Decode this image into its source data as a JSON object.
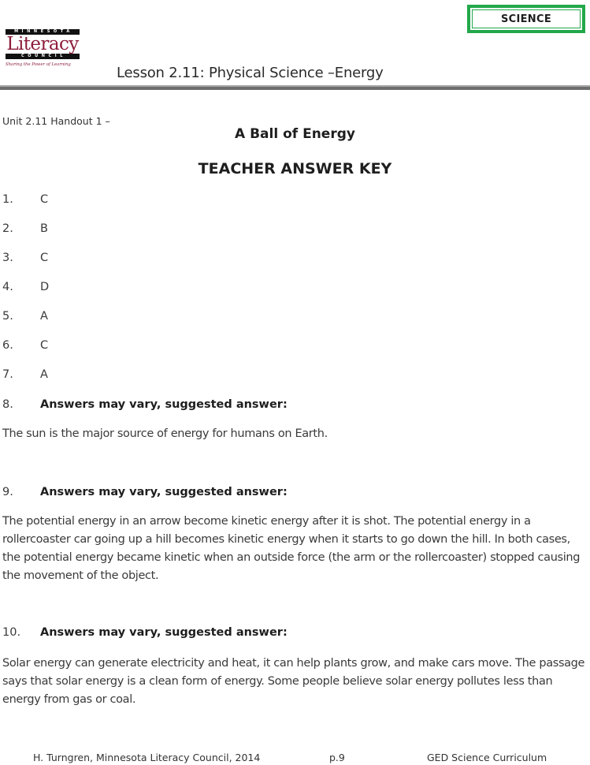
{
  "badge": {
    "label": "SCIENCE",
    "color": "#22a84a"
  },
  "logo": {
    "top_bar": "MINNESOTA",
    "word": "Literacy",
    "bottom_bar": "COUNCIL",
    "tagline": "Sharing the Power of Learning",
    "color": "#8c1d3a"
  },
  "header": {
    "lesson_title": "Lesson 2.11: Physical Science –Energy"
  },
  "document": {
    "unit_label": "Unit 2.11 Handout 1 –",
    "title": "A Ball of Energy",
    "subtitle": "TEACHER ANSWER KEY",
    "multiple_choice": [
      {
        "num": "1.",
        "answer": "C"
      },
      {
        "num": "2.",
        "answer": "B"
      },
      {
        "num": "3.",
        "answer": "C"
      },
      {
        "num": "4.",
        "answer": "D"
      },
      {
        "num": "5.",
        "answer": "A"
      },
      {
        "num": "6.",
        "answer": "C"
      },
      {
        "num": "7.",
        "answer": "A"
      }
    ],
    "open_questions": [
      {
        "num": "8.",
        "prompt": "Answers may vary, suggested answer:",
        "answer": "The sun is the major source of energy for humans on Earth."
      },
      {
        "num": "9.",
        "prompt": "Answers may vary, suggested answer:",
        "answer": "The potential energy in an arrow become kinetic energy after it is shot.  The potential energy in a rollercoaster car going up a hill becomes kinetic energy when it starts to go down the hill.  In both cases, the potential energy became kinetic when an outside force (the arm or the rollercoaster) stopped causing the movement of the object."
      },
      {
        "num": "10.",
        "prompt": "Answers may vary, suggested answer:",
        "answer": "Solar energy can generate electricity and heat, it can help plants grow, and make cars move.  The passage says that solar energy is a clean form of energy.  Some people believe solar energy pollutes less than energy from gas or coal."
      }
    ]
  },
  "footer": {
    "left": "H. Turngren, Minnesota Literacy Council, 2014",
    "page": "p.9",
    "right": "GED Science Curriculum"
  }
}
